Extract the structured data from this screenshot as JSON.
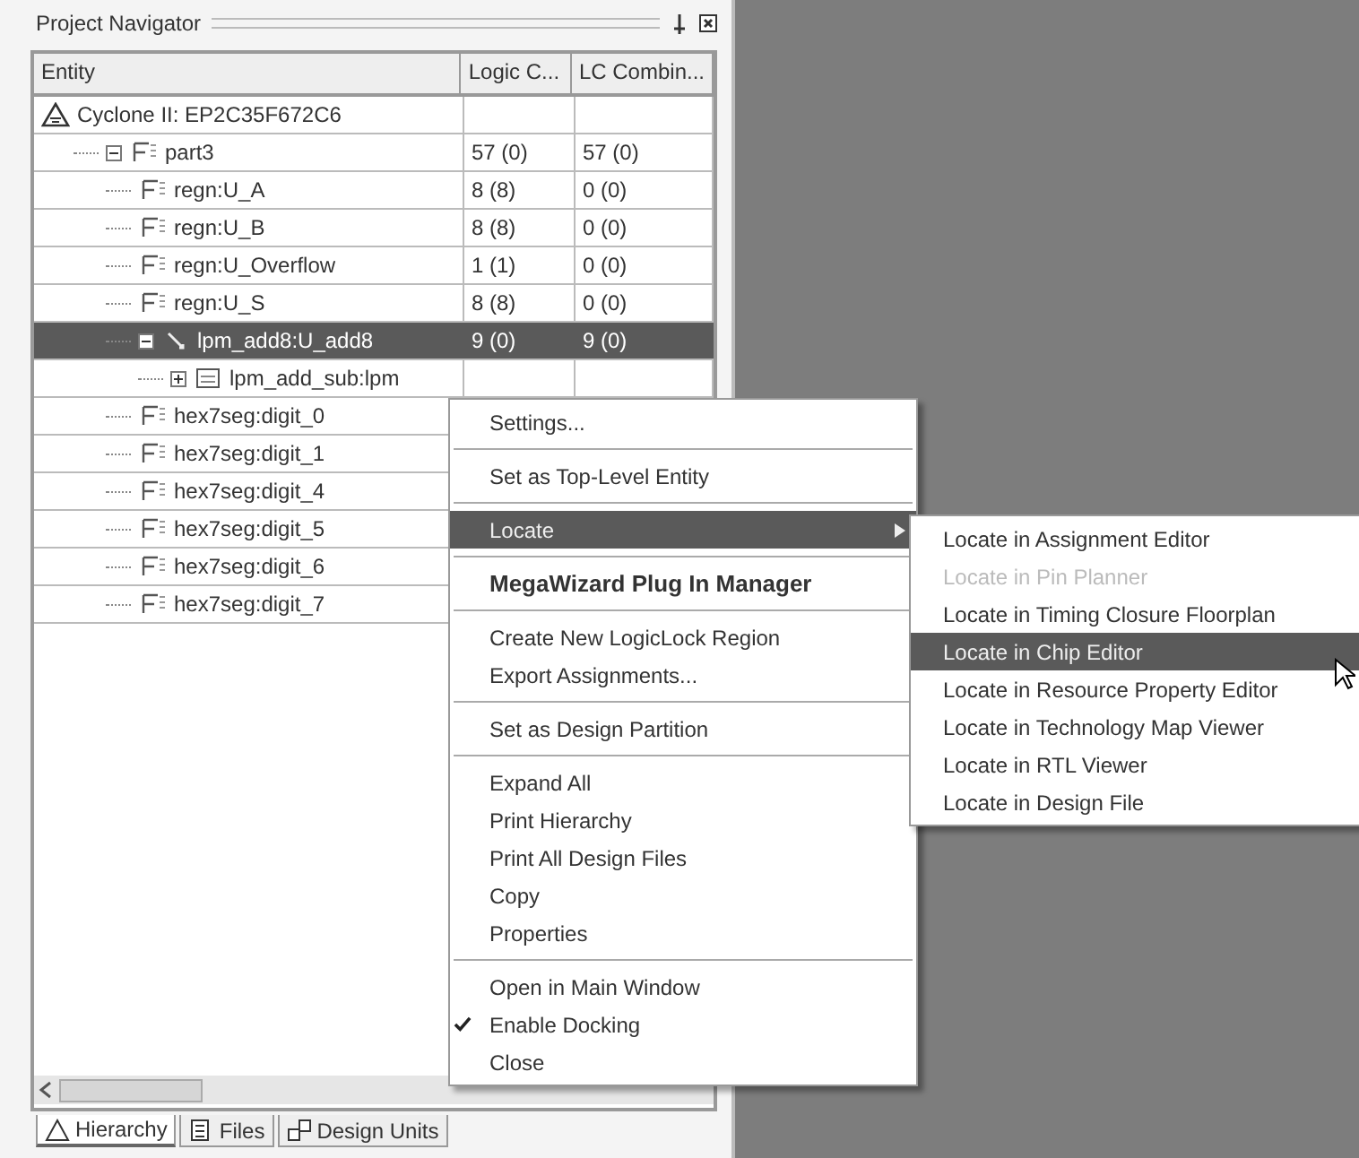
{
  "panel": {
    "title": "Project Navigator"
  },
  "table": {
    "columns": [
      "Entity",
      "Logic C...",
      "LC Combin..."
    ],
    "rows": [
      {
        "kind": "device",
        "name": "Cyclone II: EP2C35F672C6",
        "selected": false,
        "children": [
          {
            "kind": "entity",
            "name": "part3",
            "logic_cells": "57 (0)",
            "lc_combinationals": "57 (0)",
            "selected": false,
            "expanded": true,
            "children": [
              {
                "kind": "entity",
                "name": "regn:U_A",
                "logic_cells": "8 (8)",
                "lc_combinationals": "0 (0)",
                "selected": false
              },
              {
                "kind": "entity",
                "name": "regn:U_B",
                "logic_cells": "8 (8)",
                "lc_combinationals": "0 (0)",
                "selected": false
              },
              {
                "kind": "entity",
                "name": "regn:U_Overflow",
                "logic_cells": "1 (1)",
                "lc_combinationals": "0 (0)",
                "selected": false
              },
              {
                "kind": "entity",
                "name": "regn:U_S",
                "logic_cells": "8 (8)",
                "lc_combinationals": "0 (0)",
                "selected": false
              },
              {
                "kind": "instance",
                "name": "lpm_add8:U_add8",
                "logic_cells": "9 (0)",
                "lc_combinationals": "9 (0)",
                "selected": true,
                "expanded": true,
                "children": [
                  {
                    "kind": "megafunction",
                    "name": "lpm_add_sub:lpm",
                    "selected": false,
                    "expanded": false
                  }
                ]
              },
              {
                "kind": "entity",
                "name": "hex7seg:digit_0",
                "selected": false
              },
              {
                "kind": "entity",
                "name": "hex7seg:digit_1",
                "selected": false
              },
              {
                "kind": "entity",
                "name": "hex7seg:digit_4",
                "selected": false
              },
              {
                "kind": "entity",
                "name": "hex7seg:digit_5",
                "selected": false
              },
              {
                "kind": "entity",
                "name": "hex7seg:digit_6",
                "selected": false
              },
              {
                "kind": "entity",
                "name": "hex7seg:digit_7",
                "selected": false
              }
            ]
          }
        ]
      }
    ]
  },
  "tabs": [
    {
      "label": "Hierarchy",
      "kind": "hierarchy",
      "selected": true
    },
    {
      "label": "Files",
      "kind": "files",
      "selected": false
    },
    {
      "label": "Design Units",
      "kind": "units",
      "selected": false
    }
  ],
  "context_menu": [
    {
      "kind": "item",
      "label": "Settings...",
      "selected": false,
      "disabled": false,
      "checked": false,
      "submenu": false
    },
    {
      "kind": "separator"
    },
    {
      "kind": "item",
      "label": "Set as Top-Level Entity",
      "selected": false,
      "disabled": false,
      "checked": false,
      "submenu": false
    },
    {
      "kind": "separator"
    },
    {
      "kind": "item",
      "label": "Locate",
      "selected": true,
      "disabled": false,
      "checked": false,
      "submenu": true
    },
    {
      "kind": "separator"
    },
    {
      "kind": "default",
      "label": "MegaWizard Plug In Manager",
      "selected": false,
      "disabled": false,
      "checked": false,
      "submenu": false
    },
    {
      "kind": "separator"
    },
    {
      "kind": "item",
      "label": "Create New LogicLock Region",
      "selected": false,
      "disabled": false,
      "checked": false,
      "submenu": false
    },
    {
      "kind": "item",
      "label": "Export Assignments...",
      "selected": false,
      "disabled": false,
      "checked": false,
      "submenu": false
    },
    {
      "kind": "separator"
    },
    {
      "kind": "item",
      "label": "Set as Design Partition",
      "selected": false,
      "disabled": false,
      "checked": false,
      "submenu": false
    },
    {
      "kind": "separator"
    },
    {
      "kind": "item",
      "label": "Expand All",
      "selected": false,
      "disabled": false,
      "checked": false,
      "submenu": false
    },
    {
      "kind": "item",
      "label": "Print Hierarchy",
      "selected": false,
      "disabled": false,
      "checked": false,
      "submenu": false
    },
    {
      "kind": "item",
      "label": "Print All Design Files",
      "selected": false,
      "disabled": false,
      "checked": false,
      "submenu": false
    },
    {
      "kind": "item",
      "label": "Copy",
      "selected": false,
      "disabled": false,
      "checked": false,
      "submenu": false
    },
    {
      "kind": "item",
      "label": "Properties",
      "selected": false,
      "disabled": false,
      "checked": false,
      "submenu": false
    },
    {
      "kind": "separator"
    },
    {
      "kind": "item",
      "label": "Open in Main Window",
      "selected": false,
      "disabled": false,
      "checked": false,
      "submenu": false
    },
    {
      "kind": "item",
      "label": "Enable Docking",
      "selected": false,
      "disabled": false,
      "checked": true,
      "submenu": false
    },
    {
      "kind": "item",
      "label": "Close",
      "selected": false,
      "disabled": false,
      "checked": false,
      "submenu": false
    }
  ],
  "submenu": [
    {
      "label": "Locate in Assignment Editor",
      "selected": false,
      "disabled": false
    },
    {
      "label": "Locate in Pin Planner",
      "selected": false,
      "disabled": true
    },
    {
      "label": "Locate in Timing Closure Floorplan",
      "selected": false,
      "disabled": false
    },
    {
      "label": "Locate in Chip Editor",
      "selected": true,
      "disabled": false
    },
    {
      "label": "Locate in Resource Property Editor",
      "selected": false,
      "disabled": false
    },
    {
      "label": "Locate in Technology Map Viewer",
      "selected": false,
      "disabled": false
    },
    {
      "label": "Locate in RTL Viewer",
      "selected": false,
      "disabled": false
    },
    {
      "label": "Locate in Design File",
      "selected": false,
      "disabled": false
    }
  ]
}
